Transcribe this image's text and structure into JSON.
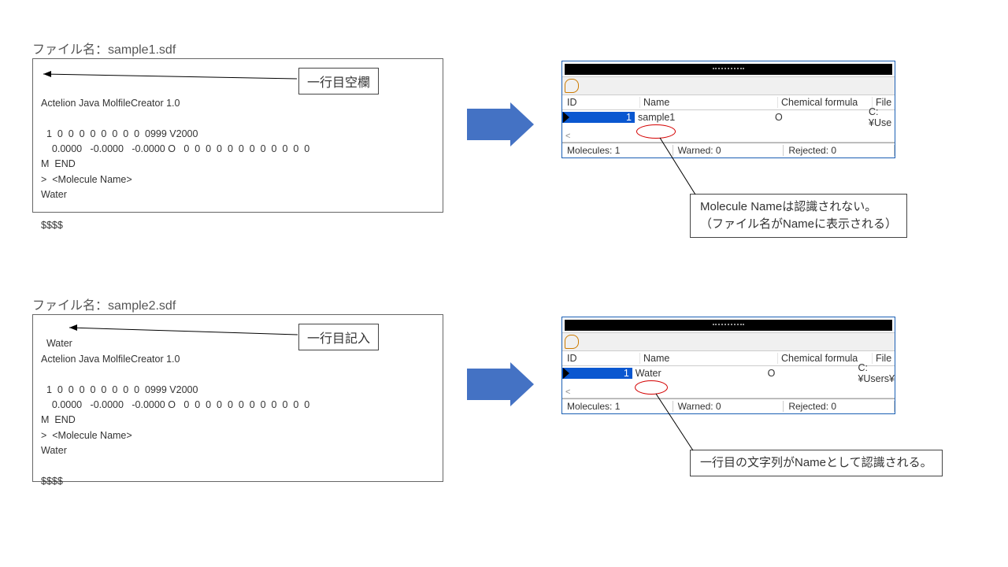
{
  "section1": {
    "file_label": "ファイル名：sample1.sdf",
    "code": "\nActelion Java MolfileCreator 1.0\n\n  1  0  0  0  0  0  0  0  0  0999 V2000\n    0.0000   -0.0000   -0.0000 O   0  0  0  0  0  0  0  0  0  0  0  0\nM  END\n>  <Molecule Name>\nWater\n\n$$$$",
    "annot_label": "一行目空欄",
    "note": "Molecule Nameは認識されない。\n（ファイル名がNameに表示される）",
    "row": {
      "id": "1",
      "name": "sample1",
      "chem": "O",
      "file": "C:¥Use"
    }
  },
  "section2": {
    "file_label": "ファイル名：sample2.sdf",
    "code": "Water\nActelion Java MolfileCreator 1.0\n\n  1  0  0  0  0  0  0  0  0  0999 V2000\n    0.0000   -0.0000   -0.0000 O   0  0  0  0  0  0  0  0  0  0  0  0\nM  END\n>  <Molecule Name>\nWater\n\n$$$$",
    "annot_label": "一行目記入",
    "note": "一行目の文字列がNameとして認識される。",
    "row": {
      "id": "1",
      "name": "Water",
      "chem": "O",
      "file": "C:¥Users¥"
    }
  },
  "table": {
    "headers": {
      "id": "ID",
      "name": "Name",
      "chem": "Chemical formula",
      "file": "File"
    },
    "status": {
      "mol": "Molecules: 1",
      "warn": "Warned: 0",
      "rej": "Rejected: 0"
    }
  }
}
